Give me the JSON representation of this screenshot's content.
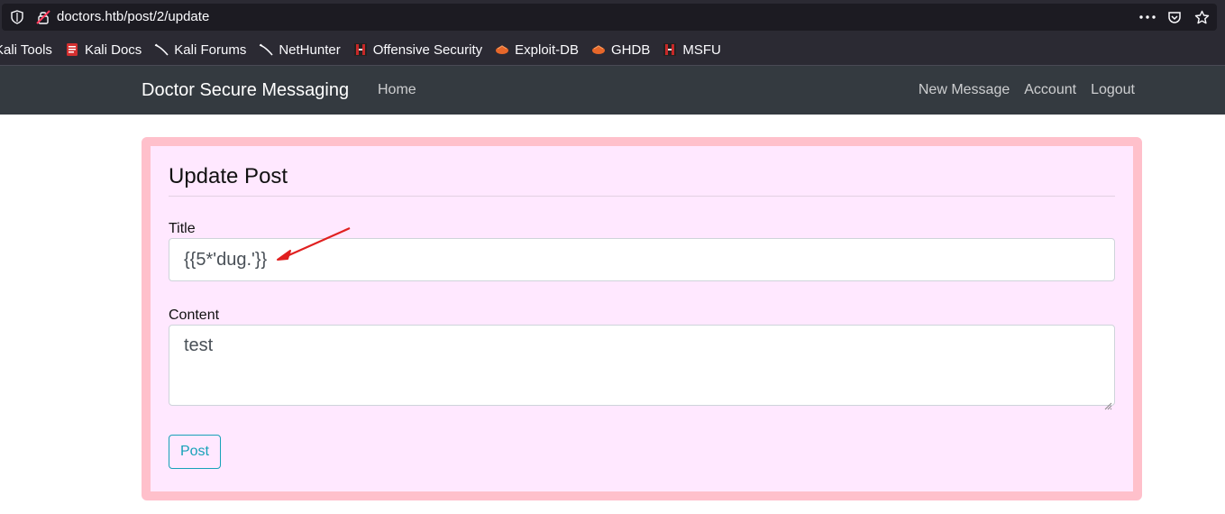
{
  "browser": {
    "url": "doctors.htb/post/2/update",
    "bookmarks": [
      {
        "label": "Kali Tools",
        "icon": "kali-icon"
      },
      {
        "label": "Kali Docs",
        "icon": "kali-docs-icon"
      },
      {
        "label": "Kali Forums",
        "icon": "kali-dragon-icon"
      },
      {
        "label": "NetHunter",
        "icon": "kali-dragon-icon"
      },
      {
        "label": "Offensive Security",
        "icon": "offsec-icon"
      },
      {
        "label": "Exploit-DB",
        "icon": "exploitdb-icon"
      },
      {
        "label": "GHDB",
        "icon": "exploitdb-icon"
      },
      {
        "label": "MSFU",
        "icon": "offsec-icon"
      }
    ]
  },
  "navbar": {
    "brand": "Doctor Secure Messaging",
    "home": "Home",
    "new_message": "New Message",
    "account": "Account",
    "logout": "Logout"
  },
  "form": {
    "legend": "Update Post",
    "title_label": "Title",
    "title_value": "{{5*'dug.'}}",
    "content_label": "Content",
    "content_value": "test",
    "submit_label": "Post"
  },
  "colors": {
    "card_bg": "#ffe8ff",
    "card_border": "#ffc0cb",
    "navbar_bg": "#343a40",
    "accent": "#17a2b8",
    "annotation_arrow": "#e02020"
  }
}
